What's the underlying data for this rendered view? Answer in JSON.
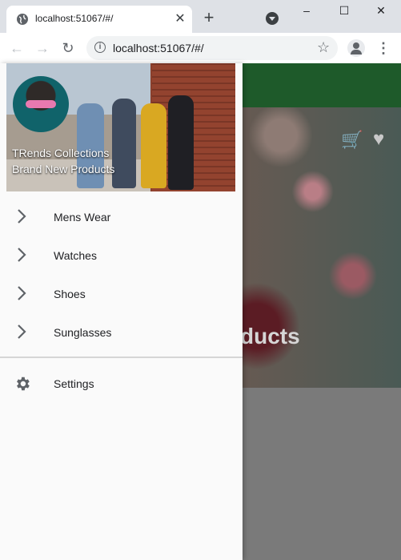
{
  "browser": {
    "tab_title": "localhost:51067/#/",
    "url": "localhost:51067/#/",
    "new_tab_symbol": "+",
    "minimize_symbol": "–",
    "maximize_symbol": "☐",
    "close_symbol": "✕"
  },
  "drawer": {
    "header": {
      "line1": "TRends Collections",
      "line2": "Brand New Products"
    },
    "items": [
      {
        "label": "Mens Wear",
        "icon": "chevron-right-icon"
      },
      {
        "label": "Watches",
        "icon": "chevron-right-icon"
      },
      {
        "label": "Shoes",
        "icon": "chevron-right-icon"
      },
      {
        "label": "Sunglasses",
        "icon": "chevron-right-icon"
      }
    ],
    "settings": {
      "label": "Settings",
      "icon": "gear-icon"
    }
  },
  "background": {
    "headline_visible": "ducts",
    "appbar_color": "#1e5a2a"
  }
}
